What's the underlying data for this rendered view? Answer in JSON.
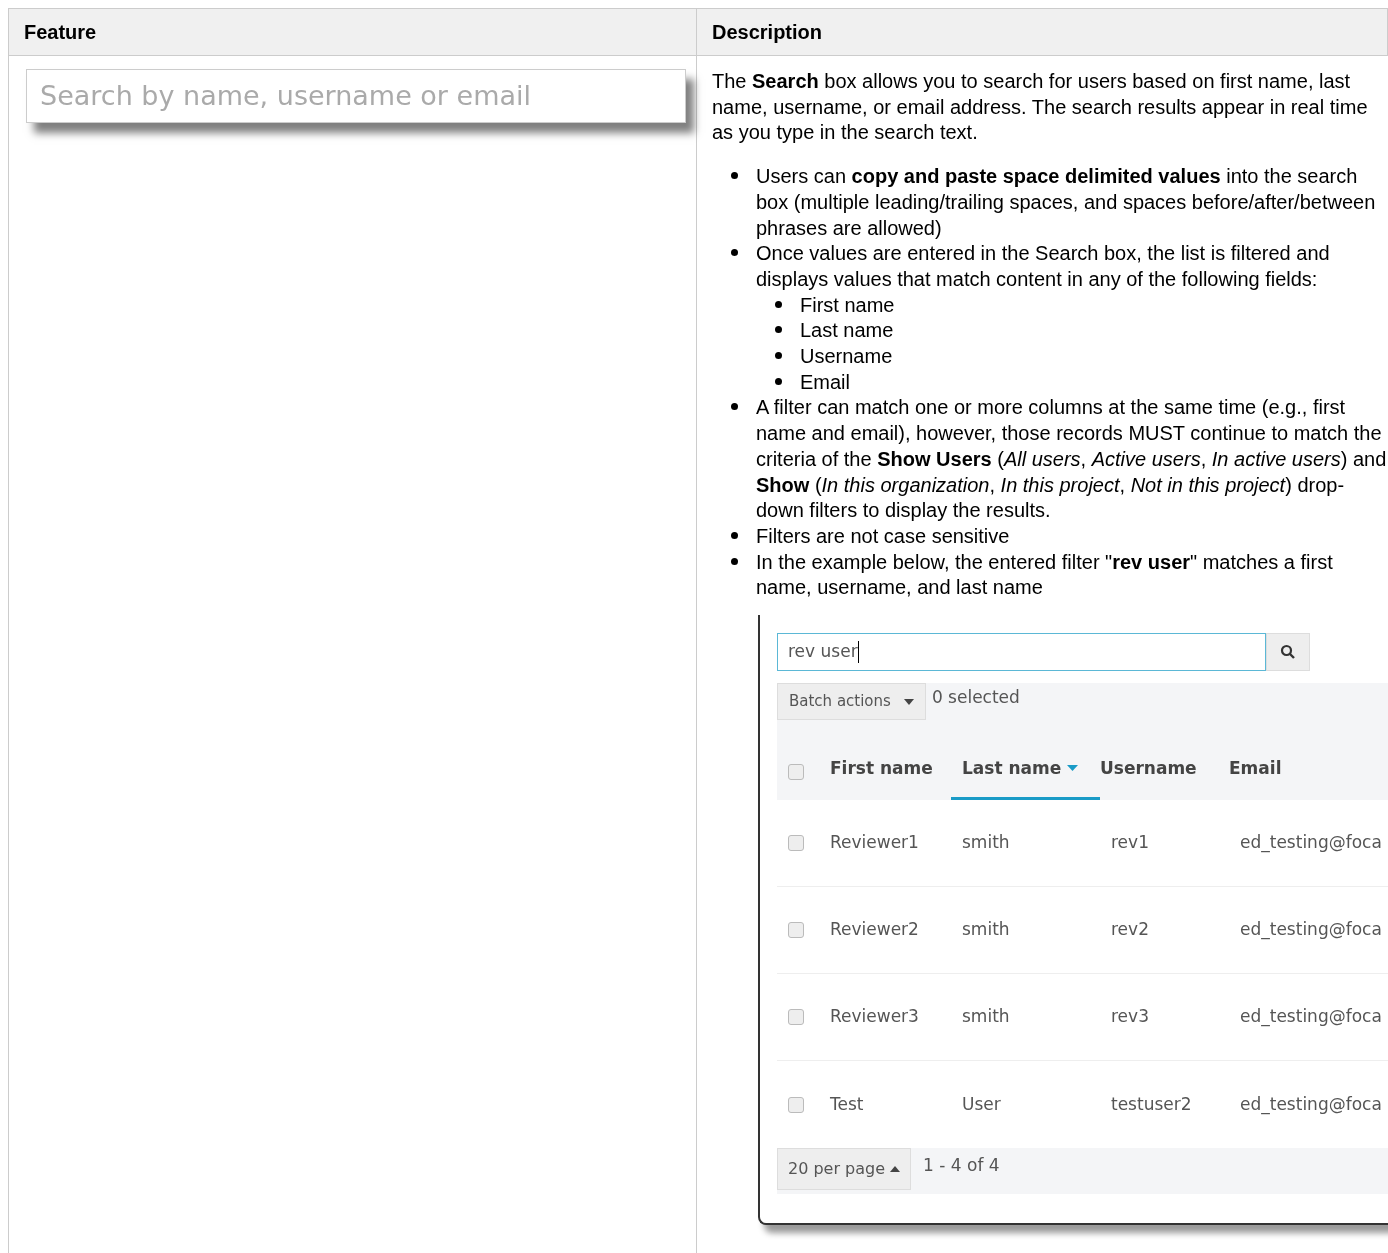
{
  "table": {
    "columns": [
      "Feature",
      "Description"
    ],
    "feature_search": {
      "placeholder": "Search by name, username or email"
    },
    "description": {
      "intro": "The **Search** box allows you to search for users based on first name, last name, username, or email address. The search results appear in real time as you type in the search text.",
      "bullets": [
        {
          "text": "Users can **copy and paste space delimited values** into the search box (multiple leading/trailing spaces, and spaces before/after/between phrases are allowed)"
        },
        {
          "text": "Once values are entered in the Search box, the list is filtered and displays values that match content in any of the following fields:",
          "children": [
            {
              "text": "First name"
            },
            {
              "text": "Last name"
            },
            {
              "text": "Username"
            },
            {
              "text": "Email"
            }
          ]
        },
        {
          "text": "A filter can match one or more columns at the same time (e.g., first name and email), however, those records MUST continue to match the criteria of the **Show Users** (*All users*, *Active users*, *In active users*) and **Show** (*In this organization*, *In this project*, *Not in this project*) drop-down filters to display the results."
        },
        {
          "text": "Filters are not case sensitive"
        },
        {
          "text": "In the example below, the entered filter \"**rev user**\" matches a first name, username, and last name"
        }
      ],
      "example": {
        "search_value": "rev user",
        "batch_button": "Batch actions",
        "selected_count": "0 selected",
        "select_all_checked": false,
        "columns": [
          {
            "label": "First name",
            "selected": false
          },
          {
            "label": "Last name",
            "selected": true
          },
          {
            "label": "Username",
            "selected": false
          },
          {
            "label": "Email",
            "selected": false
          }
        ],
        "rows": [
          {
            "checked": false,
            "cells": [
              "Reviewer1",
              "smith",
              "rev1",
              "ed_testing@foca"
            ]
          },
          {
            "checked": false,
            "cells": [
              "Reviewer2",
              "smith",
              "rev2",
              "ed_testing@foca"
            ]
          },
          {
            "checked": false,
            "cells": [
              "Reviewer3",
              "smith",
              "rev3",
              "ed_testing@foca"
            ]
          },
          {
            "checked": false,
            "cells": [
              "Test",
              "User",
              "testuser2",
              "ed_testing@foca"
            ]
          }
        ],
        "per_page": "20 per page",
        "range": "1 - 4 of 4"
      }
    }
  }
}
